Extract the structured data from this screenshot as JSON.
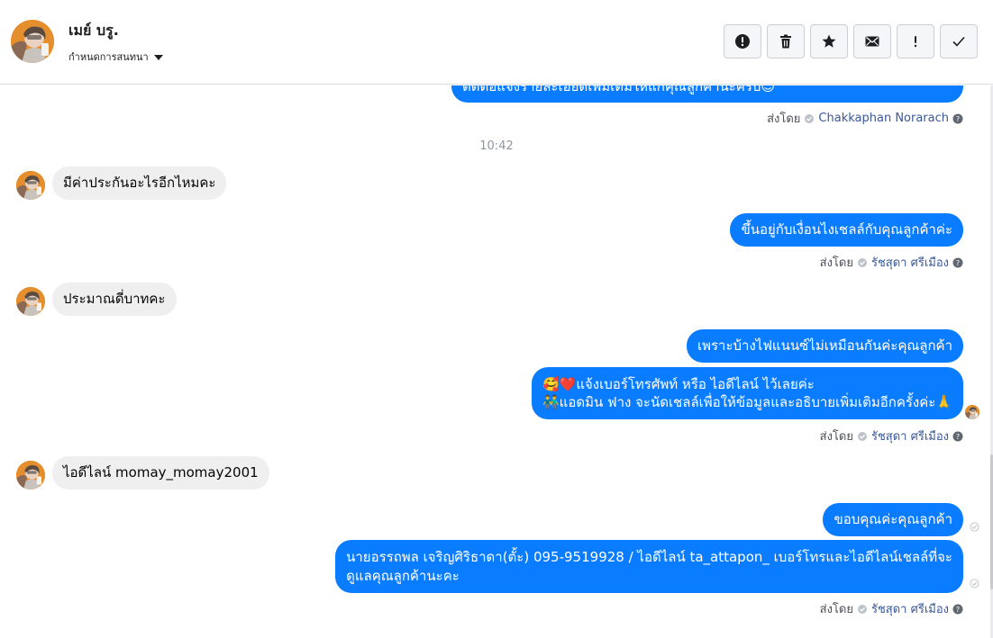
{
  "header": {
    "contact_name": "เมย์ บรู.",
    "assign_label": "กำหนดการสนทนา",
    "toolbar": [
      {
        "name": "report-icon"
      },
      {
        "name": "trash-icon"
      },
      {
        "name": "star-icon"
      },
      {
        "name": "envelope-icon"
      },
      {
        "name": "exclamation-icon"
      },
      {
        "name": "checkmark-icon"
      }
    ]
  },
  "thread": {
    "partial_message": "ติดต่อแจ้งรายละเอียดเพิ่มเติมให้แก่คุณลูกค้านะครับ😊",
    "sent_by_1": {
      "label": "ส่งโดย",
      "agent": "Chakkaphan Norarach"
    },
    "time_separator": "10:42",
    "msg_in_1": "มีค่าประกันอะไรอีกไหมคะ",
    "msg_out_1": "ขึ้นอยู่กับเงื่อนไงเชลล์กับคุณลูกค้าค่ะ",
    "sent_by_2": {
      "label": "ส่งโดย",
      "agent": "รัชสุดา ศรีเมือง"
    },
    "msg_in_2": "ประมาณดี่บาทคะ",
    "msg_out_2": "เพราะบ้างไฟแนนซ์ไม่เหมือนกันค่ะคุณลูกค้า",
    "msg_out_3_line1": "🥰❤️แจ้งเบอร์โทรศัพท์ หรือ ไอดีไลน์  ไว้เลยค่ะ",
    "msg_out_3_line2": "👬แอดมิน ฟาง จะนัดเชลล์เพื่อให้ข้อมูลและอธิบายเพิ่มเติมอีกครั้งค่ะ🙏",
    "sent_by_3": {
      "label": "ส่งโดย",
      "agent": "รัชสุดา ศรีเมือง"
    },
    "msg_in_3": "ไอดีไลน์ momay_momay2001",
    "msg_out_4": "ขอบคุณค่ะคุณลูกค้า",
    "msg_out_5_line1": "นายอรรถพล เจริญศิริธาดา(ตั้ะ)       095-9519928 / ไอดีไลน์ ta_attapon_  เบอร์โทรและไอดีไลน์เชลล์ที่จะ",
    "msg_out_5_line2": "ดูแลคุณลูกค้านะคะ",
    "sent_by_4": {
      "label": "ส่งโดย",
      "agent": "รัชสุดา ศรีเมือง"
    }
  },
  "colors": {
    "outgoing_bubble": "#0a7cff",
    "incoming_bubble": "#efefef",
    "agent_link": "#385898",
    "avatar_bg": "#e58e2d"
  }
}
